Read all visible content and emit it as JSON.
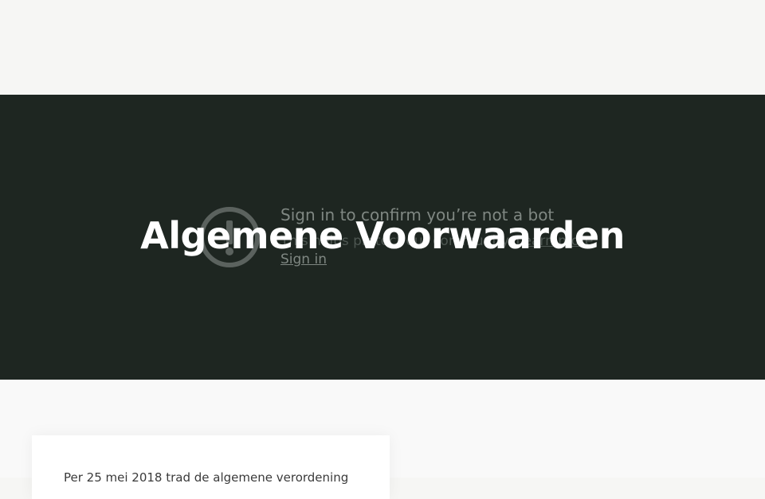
{
  "hero": {
    "title": "Algemene Voorwaarden",
    "bot_prompt": {
      "icon": "warning-circle-icon",
      "title": "Sign in to confirm you’re not a bot",
      "subtitle_prefix": "This helps protect our community.",
      "learn_more": "Learn more",
      "sign_in": "Sign in"
    }
  },
  "content": {
    "intro_text": "Per 25 mei 2018 trad de algemene verordening"
  },
  "colors": {
    "hero_background": "#1e2621",
    "page_background": "#f6f6f4",
    "title": "#ffffff"
  }
}
